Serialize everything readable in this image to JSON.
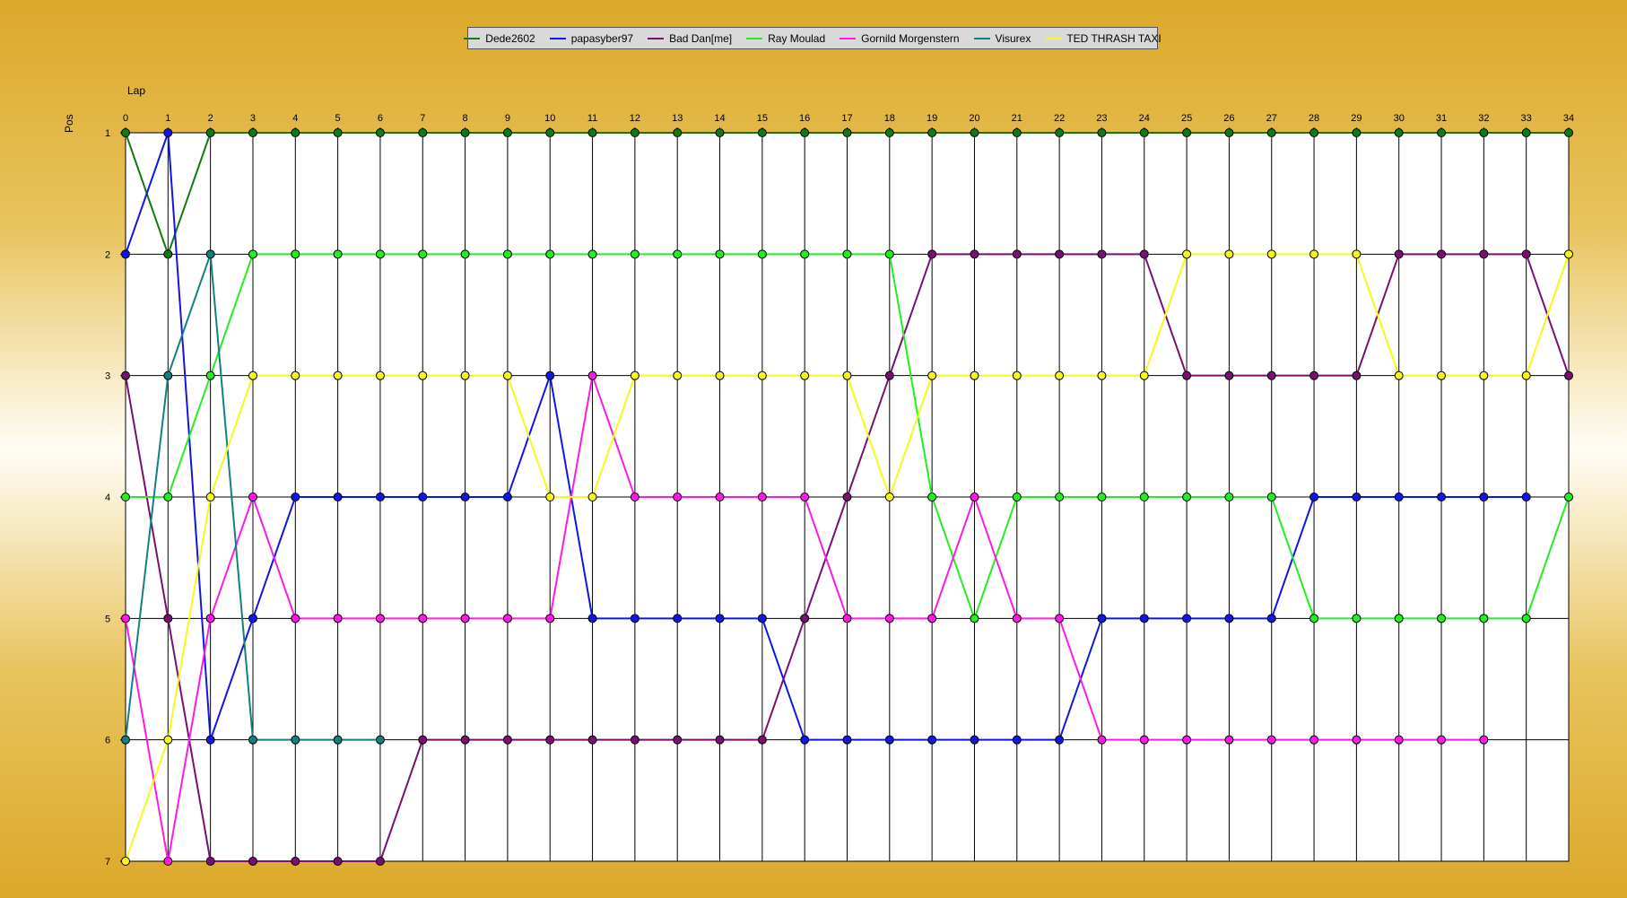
{
  "legend": [
    {
      "name": "Dede2602",
      "color": "#117a11"
    },
    {
      "name": "papasyber97",
      "color": "#0f16e6"
    },
    {
      "name": "Bad Dan[me]",
      "color": "#7a0f6f"
    },
    {
      "name": "Ray Moulad",
      "color": "#22ee22"
    },
    {
      "name": "Gornild Morgenstern",
      "color": "#ff19e6"
    },
    {
      "name": "Visurex",
      "color": "#138080"
    },
    {
      "name": "TED THRASH TAXI",
      "color": "#f8f81a"
    }
  ],
  "chart_data": {
    "type": "line",
    "xlabel": "Lap",
    "ylabel": "Pos",
    "x": [
      0,
      1,
      2,
      3,
      4,
      5,
      6,
      7,
      8,
      9,
      10,
      11,
      12,
      13,
      14,
      15,
      16,
      17,
      18,
      19,
      20,
      21,
      22,
      23,
      24,
      25,
      26,
      27,
      28,
      29,
      30,
      31,
      32,
      33,
      34
    ],
    "ylim": [
      1,
      7
    ],
    "y_inverted": true,
    "grid": true,
    "legend_position": "top-center",
    "series": [
      {
        "name": "Dede2602",
        "color": "#117a11",
        "values": [
          1,
          2,
          1,
          1,
          1,
          1,
          1,
          1,
          1,
          1,
          1,
          1,
          1,
          1,
          1,
          1,
          1,
          1,
          1,
          1,
          1,
          1,
          1,
          1,
          1,
          1,
          1,
          1,
          1,
          1,
          1,
          1,
          1,
          1,
          1
        ]
      },
      {
        "name": "papasyber97",
        "color": "#0f16e6",
        "values": [
          2,
          1,
          6,
          5,
          4,
          4,
          4,
          4,
          4,
          4,
          3,
          5,
          5,
          5,
          5,
          5,
          6,
          6,
          6,
          6,
          6,
          6,
          6,
          5,
          5,
          5,
          5,
          5,
          4,
          4,
          4,
          4,
          4,
          4,
          null
        ]
      },
      {
        "name": "Bad Dan[me]",
        "color": "#7a0f6f",
        "values": [
          3,
          5,
          7,
          7,
          7,
          7,
          7,
          6,
          6,
          6,
          6,
          6,
          6,
          6,
          6,
          6,
          5,
          4,
          3,
          2,
          2,
          2,
          2,
          2,
          2,
          3,
          3,
          3,
          3,
          3,
          2,
          2,
          2,
          2,
          3
        ]
      },
      {
        "name": "Ray Moulad",
        "color": "#22ee22",
        "values": [
          4,
          4,
          3,
          2,
          2,
          2,
          2,
          2,
          2,
          2,
          2,
          2,
          2,
          2,
          2,
          2,
          2,
          2,
          2,
          4,
          5,
          4,
          4,
          4,
          4,
          4,
          4,
          4,
          5,
          5,
          5,
          5,
          5,
          5,
          4
        ]
      },
      {
        "name": "Gornild Morgenstern",
        "color": "#ff19e6",
        "values": [
          5,
          7,
          5,
          4,
          5,
          5,
          5,
          5,
          5,
          5,
          5,
          3,
          4,
          4,
          4,
          4,
          4,
          5,
          5,
          5,
          4,
          5,
          5,
          6,
          6,
          6,
          6,
          6,
          6,
          6,
          6,
          6,
          6,
          null,
          null
        ]
      },
      {
        "name": "Visurex",
        "color": "#138080",
        "values": [
          6,
          3,
          2,
          6,
          6,
          6,
          6,
          null,
          null,
          null,
          null,
          null,
          null,
          null,
          null,
          null,
          null,
          null,
          null,
          null,
          null,
          null,
          null,
          null,
          null,
          null,
          null,
          null,
          null,
          null,
          null,
          null,
          null,
          null,
          null
        ]
      },
      {
        "name": "TED THRASH TAXI",
        "color": "#f8f81a",
        "values": [
          7,
          6,
          4,
          3,
          3,
          3,
          3,
          3,
          3,
          3,
          4,
          4,
          3,
          3,
          3,
          3,
          3,
          3,
          4,
          3,
          3,
          3,
          3,
          3,
          3,
          2,
          2,
          2,
          2,
          2,
          3,
          3,
          3,
          3,
          2
        ]
      }
    ]
  }
}
